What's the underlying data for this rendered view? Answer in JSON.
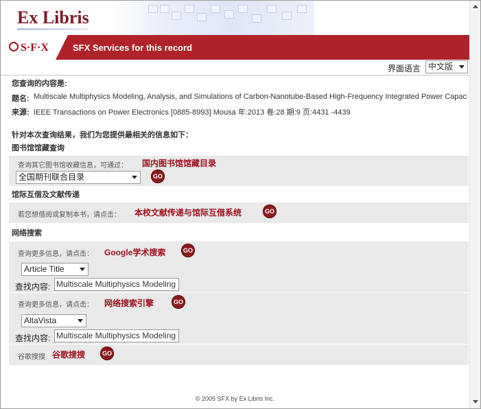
{
  "header": {
    "logo_text": "Ex Libris"
  },
  "bar": {
    "sfx_logo": "S·F·X",
    "title": "SFX Services for this record"
  },
  "language": {
    "label": "界面语言",
    "selected": "中文版"
  },
  "query": {
    "heading": "您查询的内容是:",
    "title_label": "题名:",
    "title_value": "Multiscale Multiphysics Modeling, Analysis, and Simulations of Carbon-Nanotube-Based High-Frequency Integrated Power Capacitor",
    "source_label": "来源:",
    "source_value": "IEEE Transactions on Power Electronics [0885-8993] Mousa 年:2013 卷:28 期:9 页:4431 -4439"
  },
  "results_intro": "针对本次查询结果，我们为您提供最相关的信息如下：",
  "library": {
    "heading": "图书馆馆藏查询",
    "hint": "查询其它图书馆收藏信息，可通过：",
    "link": "国内图书馆馆藏目录",
    "select_value": "全国期刊联合目录",
    "go": "GO"
  },
  "ill": {
    "heading": "馆际互借及文献传递",
    "hint": "若您想借阅或复制本书，请点击：",
    "link": "本校文献传递与馆际互借系统",
    "go": "GO"
  },
  "web": {
    "heading": "网络搜索",
    "google": {
      "hint": "查询更多信息，请点击：",
      "link": "Google学术搜索",
      "go": "GO",
      "select_value": "Article Title",
      "search_label": "查找内容:",
      "search_value": "Multiscale Multiphysics Modeling"
    },
    "engine": {
      "hint": "查询更多信息，请点击：",
      "link": "网络搜索引擎",
      "go": "GO",
      "select_value": "AltaVista",
      "search_label": "查找内容:",
      "search_value": "Multiscale Multiphysics Modeling"
    },
    "guge": {
      "hint": "谷歌搜搜",
      "link": "谷歌搜搜",
      "go": "GO"
    }
  },
  "footer": "© 2005 SFX by Ex Libris Inc.",
  "colors": {
    "brand_red": "#b0222a",
    "link_red": "#a0101e",
    "panel_gray": "#e9e9e9"
  }
}
